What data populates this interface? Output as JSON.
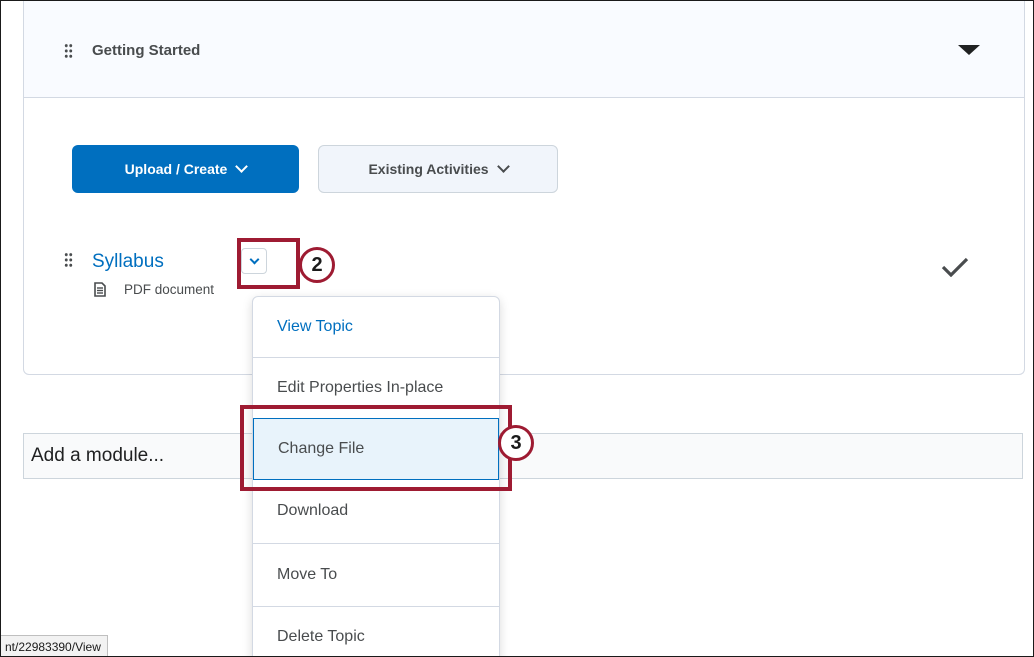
{
  "module": {
    "title": "Getting Started"
  },
  "actions": {
    "upload_create_label": "Upload / Create",
    "existing_activities_label": "Existing Activities"
  },
  "topic": {
    "title": "Syllabus",
    "type_label": "PDF document"
  },
  "add_module": {
    "placeholder": "Add a module..."
  },
  "menu": {
    "items": [
      {
        "label": "View Topic"
      },
      {
        "label": "Edit Properties In-place"
      },
      {
        "label": "Change File"
      },
      {
        "label": "Download"
      },
      {
        "label": "Move To"
      },
      {
        "label": "Delete Topic"
      }
    ]
  },
  "callouts": {
    "dropdown_step": "2",
    "change_file_step": "3"
  },
  "status_bar": {
    "url": "nt/22983390/View"
  },
  "colors": {
    "accent": "#006fbf",
    "highlight": "#9e1b32",
    "text": "#494c4e"
  }
}
